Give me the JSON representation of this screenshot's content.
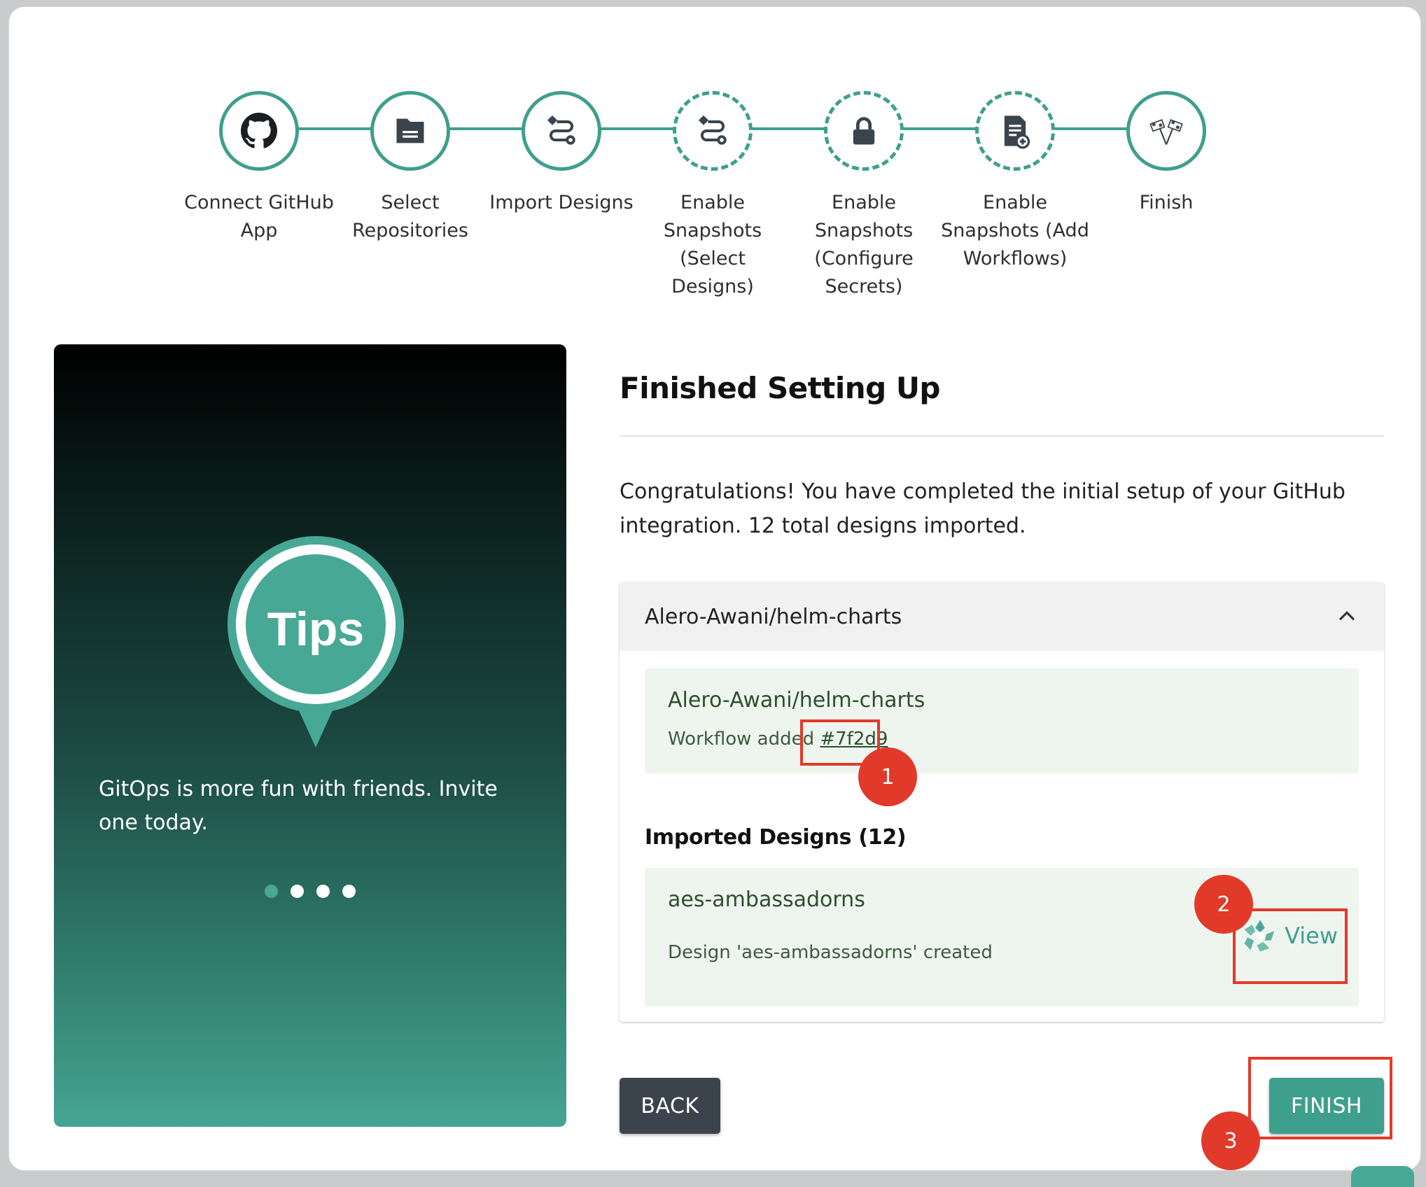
{
  "stepper": {
    "steps": [
      {
        "label": "Connect GitHub\nApp",
        "icon": "github-icon",
        "state": "completed"
      },
      {
        "label": "Select\nRepositories",
        "icon": "folder-icon",
        "state": "completed"
      },
      {
        "label": "Import Designs",
        "icon": "workflow-icon",
        "state": "completed"
      },
      {
        "label": "Enable\nSnapshots\n(Select Designs)",
        "icon": "workflow-icon",
        "state": "skipped"
      },
      {
        "label": "Enable\nSnapshots\n(Configure\nSecrets)",
        "icon": "lock-icon",
        "state": "skipped"
      },
      {
        "label": "Enable\nSnapshots (Add\nWorkflows)",
        "icon": "document-add-icon",
        "state": "skipped"
      },
      {
        "label": "Finish",
        "icon": "checkered-flags-icon",
        "state": "active"
      }
    ]
  },
  "tips": {
    "badge_text": "Tips",
    "message": "GitOps is more fun with friends. Invite one today.",
    "dot_count": 4,
    "active_dot": 0
  },
  "main": {
    "title": "Finished Setting Up",
    "message": "Congratulations! You have completed the initial setup of your GitHub integration. 12 total designs imported.",
    "accordion": {
      "title": "Alero-Awani/helm-charts",
      "expanded": true,
      "repo_card": {
        "name": "Alero-Awani/helm-charts",
        "workflow_prefix": "Workflow added ",
        "workflow_link": "#7f2d9"
      },
      "designs_heading": "Imported Designs (12)",
      "design_card": {
        "name": "aes-ambassadorns",
        "status": "Design 'aes-ambassadorns' created",
        "view_label": "View"
      }
    },
    "back_label": "BACK",
    "finish_label": "FINISH"
  },
  "annotations": [
    "1",
    "2",
    "3"
  ],
  "colors": {
    "accent": "#3f9f8d",
    "annotation": "#e23a2a",
    "back_button": "#3b444c",
    "card_bg": "#eef5ee"
  }
}
